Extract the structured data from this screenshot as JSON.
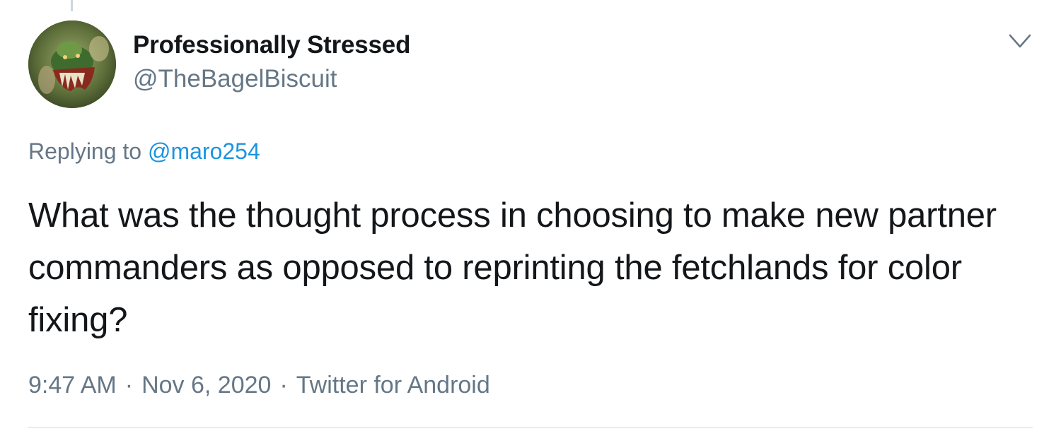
{
  "tweet": {
    "author": {
      "display_name": "Professionally Stressed",
      "handle": "@TheBagelBiscuit",
      "avatar_icon": "avatar-image"
    },
    "reply": {
      "prefix": "Replying to",
      "mention": "@maro254"
    },
    "text": "What was the thought process in choosing to make new partner commanders as opposed to reprinting the fetchlands for color fixing?",
    "meta": {
      "time": "9:47 AM",
      "date": "Nov 6, 2020",
      "source": "Twitter for Android",
      "separator": "·"
    },
    "menu_icon": "chevron-down-icon"
  },
  "colors": {
    "text_primary": "#14171a",
    "text_secondary": "#657786",
    "link": "#1b95e0",
    "divider": "#e6ecf0"
  }
}
